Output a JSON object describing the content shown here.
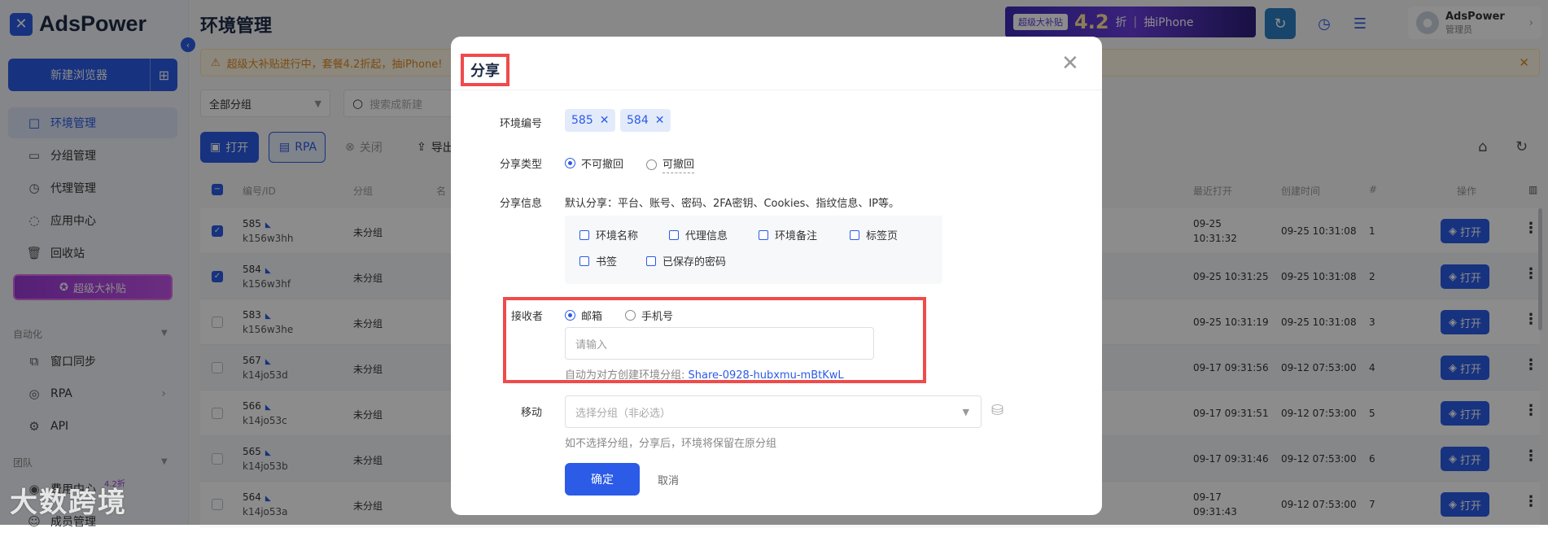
{
  "app": {
    "logo_mark": "✕",
    "logo_text": "AdsPower"
  },
  "sidebar": {
    "new_browser_label": "新建浏览器",
    "new_browser_plus": "⊞",
    "collapse_icon": "‹",
    "items": [
      {
        "label": "环境管理",
        "icon": "□",
        "active": true
      },
      {
        "label": "分组管理",
        "icon": "▭"
      },
      {
        "label": "代理管理",
        "icon": "◷"
      },
      {
        "label": "应用中心",
        "icon": "◌"
      },
      {
        "label": "回收站",
        "icon": "🗑"
      }
    ],
    "promo_label": "超级大补贴",
    "section_automation": "自动化",
    "automation_items": [
      {
        "label": "窗口同步",
        "icon": "⧉"
      },
      {
        "label": "RPA",
        "icon": "◎"
      },
      {
        "label": "API",
        "icon": "⚙"
      }
    ],
    "section_team": "团队",
    "team_items": [
      {
        "label": "费用中心",
        "badge": "4.2折"
      },
      {
        "label": "成员管理"
      }
    ]
  },
  "watermark": "大数跨境",
  "header": {
    "title": "环境管理",
    "banner": {
      "tag": "超级大补贴",
      "big": "4.2",
      "suffix": "折",
      "text": "抽iPhone"
    },
    "user_name": "AdsPower",
    "user_role": "管理员"
  },
  "notice": {
    "text": "超级大补贴进行中，套餐4.2折起，抽iPhone!"
  },
  "filters": {
    "group_select": "全部分组",
    "search_placeholder": "搜索成新建"
  },
  "toolbar": {
    "open": "打开",
    "rpa": "RPA",
    "close": "关闭",
    "export": "导出"
  },
  "table": {
    "headers": {
      "id": "编号/ID",
      "group": "分组",
      "name": "名",
      "last_open": "最近打开",
      "created": "创建时间",
      "seq": "#",
      "actions": "操作"
    },
    "open_label": "打开",
    "rows": [
      {
        "num": "585",
        "code": "k156w3hh",
        "group": "未分组",
        "last_open_1": "09-25",
        "last_open_2": "10:31:32",
        "created": "09-25 10:31:08",
        "seq": "1",
        "checked": true
      },
      {
        "num": "584",
        "code": "k156w3hf",
        "group": "未分组",
        "last_open_1": "09-25 10:31:25",
        "last_open_2": "",
        "created": "09-25 10:31:08",
        "seq": "2",
        "checked": true
      },
      {
        "num": "583",
        "code": "k156w3he",
        "group": "未分组",
        "last_open_1": "09-25 10:31:19",
        "last_open_2": "",
        "created": "09-25 10:31:08",
        "seq": "3",
        "checked": false
      },
      {
        "num": "567",
        "code": "k14jo53d",
        "group": "未分组",
        "last_open_1": "09-17 09:31:56",
        "last_open_2": "",
        "created": "09-12 07:53:00",
        "seq": "4",
        "checked": false
      },
      {
        "num": "566",
        "code": "k14jo53c",
        "group": "未分组",
        "last_open_1": "09-17 09:31:51",
        "last_open_2": "",
        "created": "09-12 07:53:00",
        "seq": "5",
        "checked": false
      },
      {
        "num": "565",
        "code": "k14jo53b",
        "group": "未分组",
        "last_open_1": "09-17 09:31:46",
        "last_open_2": "",
        "created": "09-12 07:53:00",
        "seq": "6",
        "checked": false
      },
      {
        "num": "564",
        "code": "k14jo53a",
        "group": "未分组",
        "last_open_1": "09-17",
        "last_open_2": "09:31:43",
        "created": "09-12 07:53:00",
        "seq": "7",
        "checked": false
      }
    ]
  },
  "modal": {
    "title": "分享",
    "close_icon": "✕",
    "env_label": "环境编号",
    "env_chips": [
      "585",
      "584"
    ],
    "share_type_label": "分享类型",
    "share_types": [
      "不可撤回",
      "可撤回"
    ],
    "share_info_label": "分享信息",
    "share_info_text": "默认分享：平台、账号、密码、2FA密钥、Cookies、指纹信息、IP等。",
    "options": [
      "环境名称",
      "代理信息",
      "环境备注",
      "标签页",
      "书签",
      "已保存的密码"
    ],
    "receiver_label": "接收者",
    "receiver_types": [
      "邮箱",
      "手机号"
    ],
    "receiver_placeholder": "请输入",
    "auto_group_hint": "自动为对方创建环境分组:",
    "auto_group_name": "Share-0928-hubxmu-mBtKwL",
    "move_label": "移动",
    "move_placeholder": "选择分组（非必选）",
    "move_hint": "如不选择分组，分享后，环境将保留在原分组",
    "confirm": "确定",
    "cancel": "取消"
  }
}
